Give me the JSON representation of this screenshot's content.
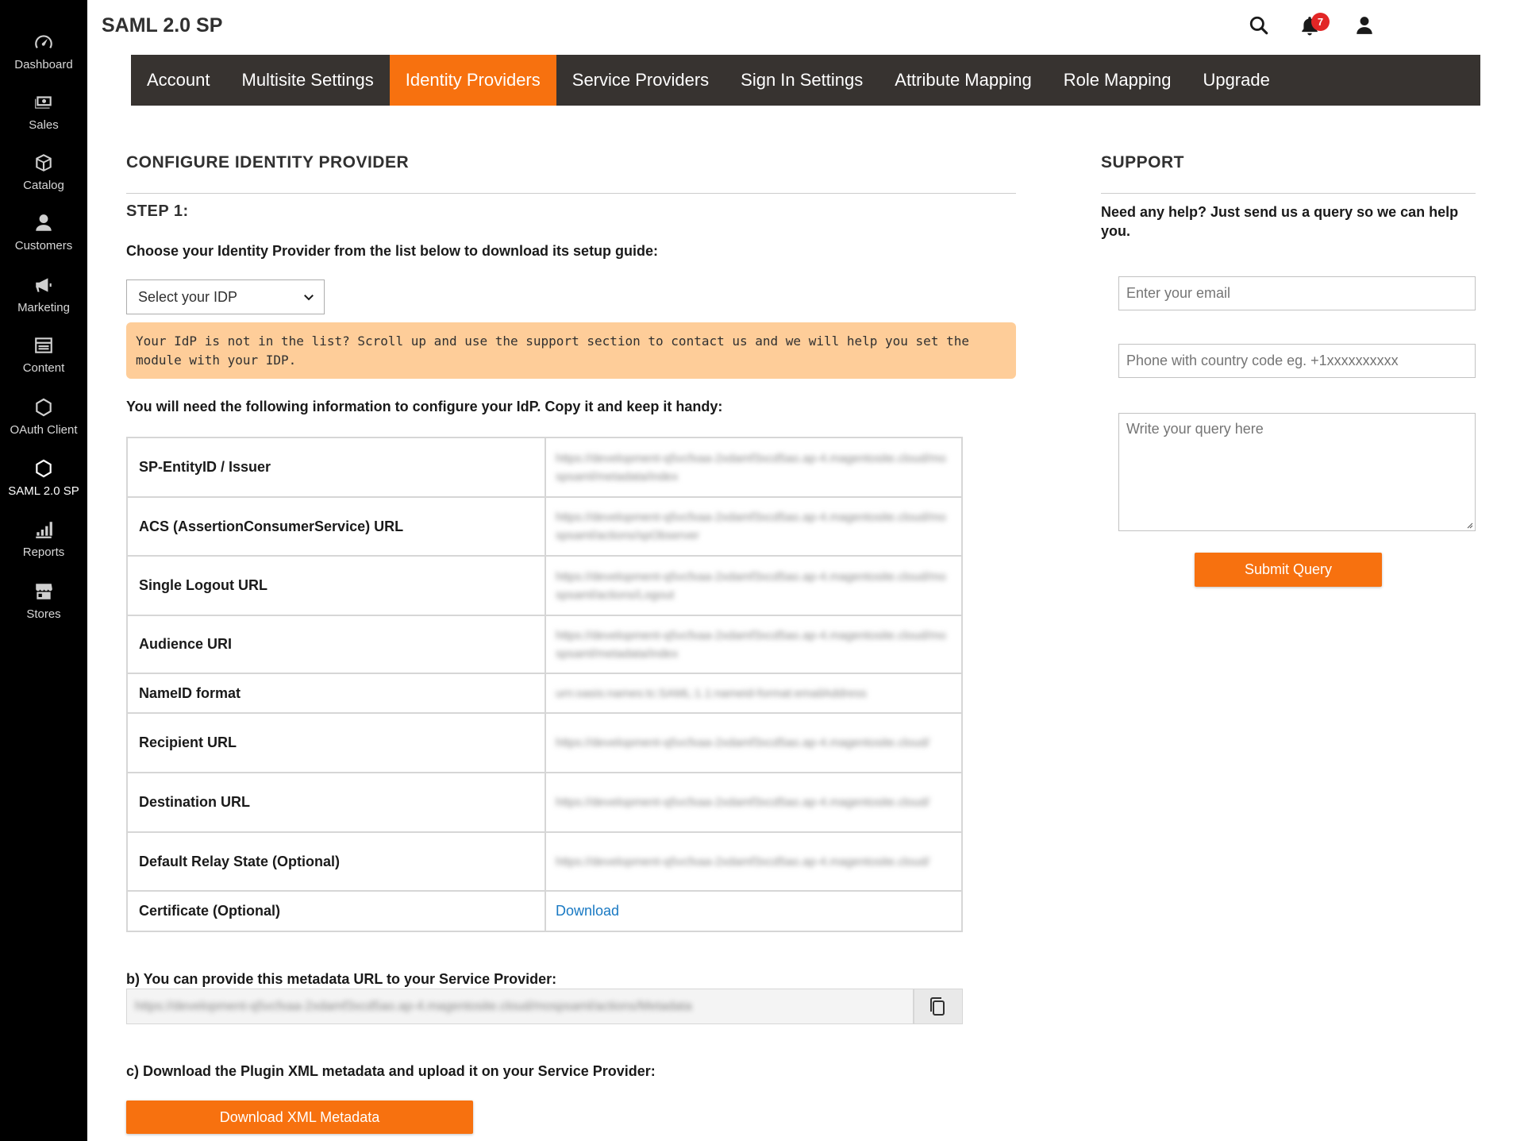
{
  "sidebar": {
    "items": [
      {
        "label": "Dashboard",
        "icon": "gauge-icon"
      },
      {
        "label": "Sales",
        "icon": "money-icon"
      },
      {
        "label": "Catalog",
        "icon": "box-icon"
      },
      {
        "label": "Customers",
        "icon": "person-icon"
      },
      {
        "label": "Marketing",
        "icon": "megaphone-icon"
      },
      {
        "label": "Content",
        "icon": "layout-icon"
      },
      {
        "label": "OAuth Client",
        "icon": "hexagon-icon"
      },
      {
        "label": "SAML 2.0 SP",
        "icon": "hexagon-icon"
      },
      {
        "label": "Reports",
        "icon": "bar-chart-icon"
      },
      {
        "label": "Stores",
        "icon": "store-icon"
      }
    ]
  },
  "header": {
    "title": "SAML 2.0 SP",
    "notification_count": "7"
  },
  "tabs": [
    {
      "label": "Account"
    },
    {
      "label": "Multisite Settings"
    },
    {
      "label": "Identity Providers"
    },
    {
      "label": "Service Providers"
    },
    {
      "label": "Sign In Settings"
    },
    {
      "label": "Attribute Mapping"
    },
    {
      "label": "Role Mapping"
    },
    {
      "label": "Upgrade"
    }
  ],
  "main": {
    "heading": "CONFIGURE IDENTITY PROVIDER",
    "step": "STEP 1:",
    "choose_text": "Choose your Identity Provider from the list below to download its setup guide:",
    "select_value": "Select your IDP",
    "notice_line1": "Your IdP is not in the list? Scroll up and use the support section to contact us and we will help you set the",
    "notice_line2": "module with your IDP.",
    "info_text": "You will need the following information to configure your IdP. Copy it and keep it handy:",
    "rows": [
      {
        "label": "SP-EntityID / Issuer",
        "value": "https://development-q5vcfxaa-2xdamf3xcd5ao.ap-4.magentosite.cloud/mospsaml/metadata/index"
      },
      {
        "label": "ACS (AssertionConsumerService) URL",
        "value": "https://development-q5vcfxaa-2xdamf3xcd5ao.ap-4.magentosite.cloud/mospsaml/actions/spObserver"
      },
      {
        "label": "Single Logout URL",
        "value": "https://development-q5vcfxaa-2xdamf3xcd5ao.ap-4.magentosite.cloud/mospsaml/actions/Logout"
      },
      {
        "label": "Audience URI",
        "value": "https://development-q5vcfxaa-2xdamf3xcd5ao.ap-4.magentosite.cloud/mospsaml/metadata/index"
      },
      {
        "label": "NameID format",
        "value": "urn:oasis:names:tc:SAML:1.1:nameid-format:emailAddress"
      },
      {
        "label": "Recipient URL",
        "value": "https://development-q5vcfxaa-2xdamf3xcd5ao.ap-4.magentosite.cloud/"
      },
      {
        "label": "Destination URL",
        "value": "https://development-q5vcfxaa-2xdamf3xcd5ao.ap-4.magentosite.cloud/"
      },
      {
        "label": "Default Relay State (Optional)",
        "value": "https://development-q5vcfxaa-2xdamf3xcd5ao.ap-4.magentosite.cloud/"
      },
      {
        "label": "Certificate (Optional)",
        "value": "Download"
      }
    ],
    "metadata_text": "b) You can provide this metadata URL to your Service Provider:",
    "metadata_url": "https://development-q5vcfxaa-2xdamf3xcd5ao.ap-4.magentosite.cloud/mospsaml/actions/Metadata",
    "download_text": "c) Download the Plugin XML metadata and upload it on your Service Provider:",
    "download_button": "Download XML Metadata"
  },
  "support": {
    "heading": "SUPPORT",
    "help_text_line1": "Need any help? Just send us a query so we can help",
    "help_text_line2": "you.",
    "email_placeholder": "Enter your email",
    "phone_placeholder": "Phone with country code eg. +1xxxxxxxxxx",
    "query_placeholder": "Write your query here",
    "submit_label": "Submit Query"
  },
  "colors": {
    "accent": "#f7710f",
    "tabbar": "#373330",
    "sidebar": "#000000",
    "notice": "#fecd99",
    "link": "#1979c3"
  }
}
